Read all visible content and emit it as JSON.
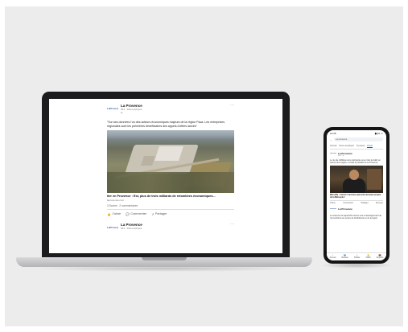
{
  "laptop_post": {
    "org_name": "La Provence",
    "org_meta_followers": "661 · 100 employés",
    "org_meta_time": "1j",
    "more_icon": "⋯",
    "text": "\"Sur ses données l'un des acteurs économiques majeurs de la région Paca. Les entreprises régionales sont les premières bénéficiaires des appels d'offres lancés\"",
    "link_title": "Iter en Provence : Est, plus de trois milliards de retombées économiques...",
    "link_domain": "laprovence.com",
    "reactions": "3 Scores · 2 commentaires",
    "actions": {
      "like": "J'aime",
      "comment": "Commenter",
      "share": "Partager"
    },
    "second_org_name": "La Provence",
    "second_org_meta": "661 · 100 employés"
  },
  "phone": {
    "status_time": "13:45",
    "status_icons": "▮▮ ≋ ▭",
    "search_text": "La provence",
    "tabs": [
      "Accueil",
      "Noms employés",
      "À propos",
      "Posts"
    ],
    "active_tab": "Posts",
    "post_org_name": "La Provence",
    "post_meta": "661 · 3j",
    "post_text": "Le 4e site d'affaires de la métropole est en train de bâtir sur l'avenir de la région, a confié le président à La Provence.",
    "image_caption": "Marseille : l'avenir s'annonce parsemé de beaux projets de la Métropole !",
    "actions": [
      "J'aime",
      "Commenter",
      "Partager",
      "Envoyer"
    ],
    "post2_org_name": "La Provence",
    "post2_text": "Le souvenir est aujourd'hui tourné vers le développement de nos territoires au service de la Métropole et de la région.",
    "nav": [
      "Accueil",
      "Réseau",
      "Publier",
      "Notifs",
      "Emplois"
    ]
  },
  "colors": {
    "accent": "#0a66c2",
    "laptop_body": "#1c1c1e",
    "backdrop": "#ececec"
  }
}
